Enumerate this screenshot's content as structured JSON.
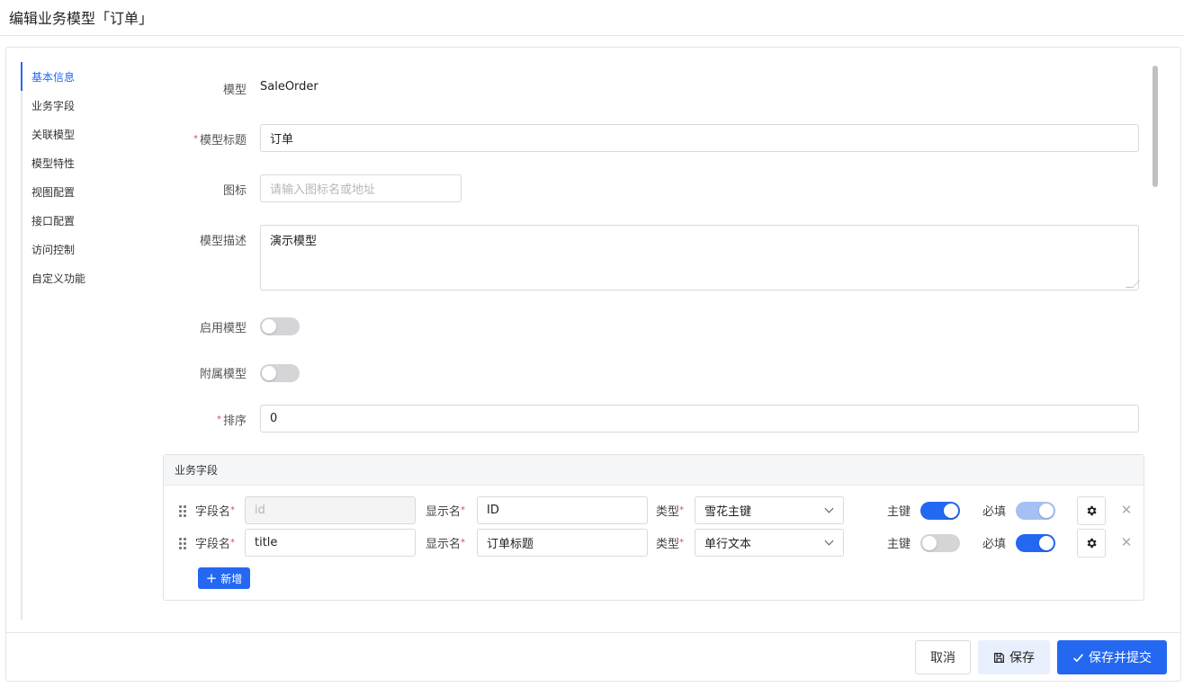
{
  "page": {
    "title": "编辑业务模型「订单」"
  },
  "anchors": [
    {
      "label": "基本信息",
      "active": true
    },
    {
      "label": "业务字段"
    },
    {
      "label": "关联模型"
    },
    {
      "label": "模型特性"
    },
    {
      "label": "视图配置"
    },
    {
      "label": "接口配置"
    },
    {
      "label": "访问控制"
    },
    {
      "label": "自定义功能"
    }
  ],
  "form": {
    "model": {
      "label": "模型",
      "value": "SaleOrder"
    },
    "title": {
      "label": "模型标题",
      "value": "订单",
      "required": true
    },
    "icon": {
      "label": "图标",
      "placeholder": "请输入图标名或地址"
    },
    "description": {
      "label": "模型描述",
      "value": "演示模型"
    },
    "enabled": {
      "label": "启用模型",
      "on": false
    },
    "attached": {
      "label": "附属模型",
      "on": false
    },
    "sort": {
      "label": "排序",
      "value": "0",
      "required": true
    }
  },
  "fields_panel": {
    "title": "业务字段",
    "labels": {
      "name": "字段名",
      "display": "显示名",
      "type": "类型",
      "primary": "主键",
      "required": "必填"
    },
    "rows": [
      {
        "name": "",
        "name_placeholder": "id",
        "name_disabled": true,
        "display": "ID",
        "type": "雪花主键",
        "primary": true,
        "required": true,
        "required_dim": true
      },
      {
        "name": "title",
        "display": "订单标题",
        "type": "单行文本",
        "primary": false,
        "required": true
      }
    ],
    "add_label": "新增"
  },
  "footer": {
    "cancel": "取消",
    "save": "保存",
    "submit": "保存并提交"
  },
  "colors": {
    "primary": "#2468f2",
    "required_star": "#e5484d"
  },
  "icons": [
    "drag-handle-icon",
    "chevron-down-icon",
    "gear-icon",
    "close-icon",
    "plus-icon",
    "save-icon",
    "check-icon"
  ]
}
